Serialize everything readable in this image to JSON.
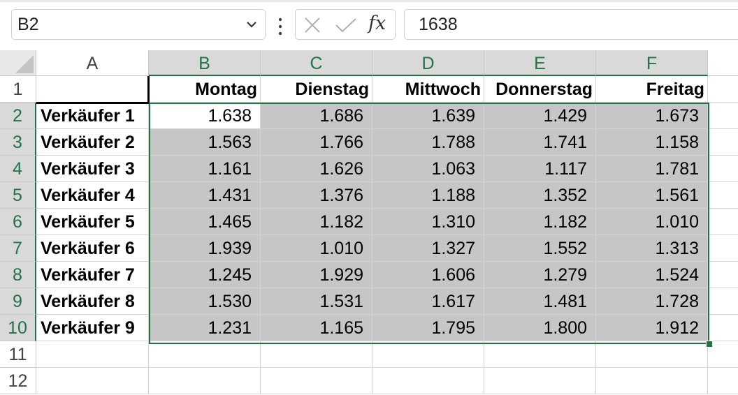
{
  "formula_bar": {
    "name_box": "B2",
    "fx_label": "fx",
    "formula_value": "1638",
    "icons": [
      "chevron-down-icon",
      "more-options-icon",
      "cancel-icon",
      "confirm-icon",
      "function-icon"
    ]
  },
  "sheet": {
    "columns": [
      "A",
      "B",
      "C",
      "D",
      "E",
      "F"
    ],
    "rows": [
      "1",
      "2",
      "3",
      "4",
      "5",
      "6",
      "7",
      "8",
      "9",
      "10",
      "11",
      "12"
    ],
    "day_headers": [
      "Montag",
      "Dienstag",
      "Mittwoch",
      "Donnerstag",
      "Freitag"
    ],
    "sellers": [
      "Verkäufer 1",
      "Verkäufer 2",
      "Verkäufer 3",
      "Verkäufer 4",
      "Verkäufer 5",
      "Verkäufer 6",
      "Verkäufer 7",
      "Verkäufer 8",
      "Verkäufer 9"
    ],
    "values": [
      [
        "1.638",
        "1.686",
        "1.639",
        "1.429",
        "1.673"
      ],
      [
        "1.563",
        "1.766",
        "1.788",
        "1.741",
        "1.158"
      ],
      [
        "1.161",
        "1.626",
        "1.063",
        "1.117",
        "1.781"
      ],
      [
        "1.431",
        "1.376",
        "1.188",
        "1.352",
        "1.561"
      ],
      [
        "1.465",
        "1.182",
        "1.310",
        "1.182",
        "1.010"
      ],
      [
        "1.939",
        "1.010",
        "1.327",
        "1.552",
        "1.313"
      ],
      [
        "1.245",
        "1.929",
        "1.606",
        "1.279",
        "1.524"
      ],
      [
        "1.530",
        "1.531",
        "1.617",
        "1.481",
        "1.728"
      ],
      [
        "1.231",
        "1.165",
        "1.795",
        "1.800",
        "1.912"
      ]
    ],
    "selected_range_columns": [
      "B",
      "C",
      "D",
      "E",
      "F"
    ],
    "selected_range_rows": [
      "2",
      "3",
      "4",
      "5",
      "6",
      "7",
      "8",
      "9",
      "10"
    ],
    "accent_color": "#217346",
    "selection_fill": "#c6c6c6"
  }
}
